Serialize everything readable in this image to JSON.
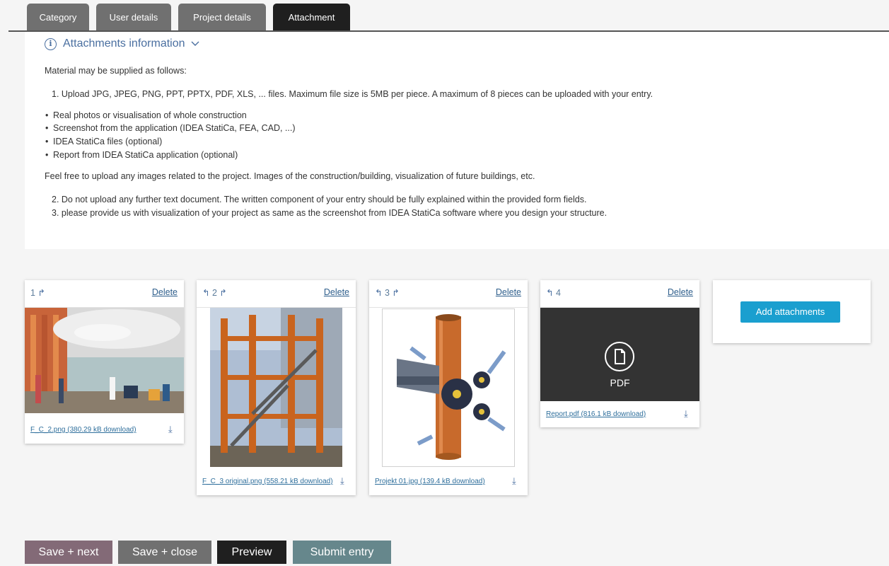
{
  "tabs": [
    "Category",
    "User details",
    "Project details",
    "Attachment"
  ],
  "info": {
    "title": "Attachments information",
    "intro": "Material may be supplied as follows:",
    "item1": "1. Upload JPG, JPEG, PNG, PPT, PPTX, PDF, XLS, ... files. Maximum file size is 5MB per piece. A maximum of 8 pieces can be uploaded with your entry.",
    "bullets": [
      "Real photos or visualisation of whole construction",
      "Screenshot from the application (IDEA StatiCa, FEA, CAD, ...)",
      "IDEA StatiCa files (optional)",
      "Report from IDEA StatiCa application (optional)"
    ],
    "free_text": "Feel free to upload any images related to the project. Images of the construction/building, visualization of future buildings, etc.",
    "item2": "2. Do not upload any further text document. The written component of your entry should be fully explained within the provided form fields.",
    "item3": "3. please provide us with visualization of your project as same as the screenshot from IDEA StatiCa software where you design your structure."
  },
  "attachments": [
    {
      "num": "1",
      "delete": "Delete",
      "file": "F_C_2.png (380.29 kB download)"
    },
    {
      "num": "2",
      "delete": "Delete",
      "file": "F_C_3 original.png (558.21 kB download)"
    },
    {
      "num": "3",
      "delete": "Delete",
      "file": "Projekt 01.jpg (139.4 kB download)"
    },
    {
      "num": "4",
      "delete": "Delete",
      "file": "Report.pdf (816.1 kB download)",
      "type_label": "PDF"
    }
  ],
  "add_attachments": "Add attachments",
  "buttons": {
    "save_next": "Save + next",
    "save_close": "Save + close",
    "preview": "Preview",
    "submit": "Submit entry"
  },
  "icons": {
    "info": "info-circle-icon",
    "chevron": "chevron-down-icon",
    "rotate_left": "rotate-left-icon",
    "rotate_right": "rotate-right-icon",
    "download": "download-icon",
    "pdf": "pdf-file-icon"
  },
  "colors": {
    "accent_blue": "#1a9fcf",
    "tab_active": "#1f1f1f",
    "tab_inactive": "#707070",
    "link": "#2f6f9c"
  }
}
